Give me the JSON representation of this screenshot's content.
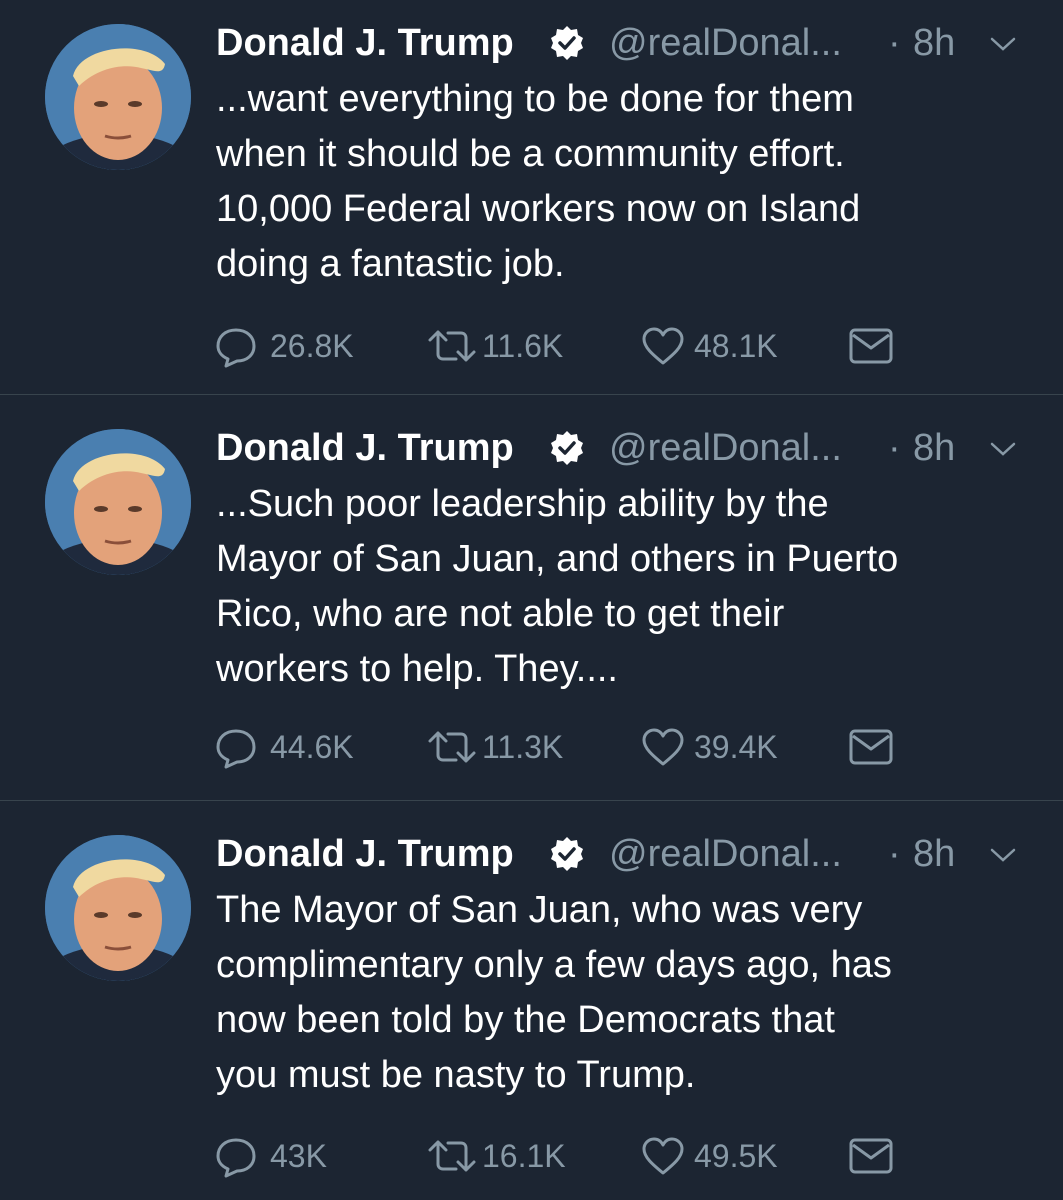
{
  "colors": {
    "background": "#1c2532",
    "divider": "#38444d",
    "text": "#ffffff",
    "muted": "#8899a6",
    "verified_badge": "#ffffff"
  },
  "tweets": [
    {
      "name": "Donald J. Trump",
      "handle": "@realDonal...",
      "dot": "·",
      "time": "8h",
      "text": "...want everything to be done for them\nwhen it should be a community effort.\n10,000 Federal workers now on Island\ndoing a fantastic job.",
      "replies": "26.8K",
      "retweets": "11.6K",
      "likes": "48.1K"
    },
    {
      "name": "Donald J. Trump",
      "handle": "@realDonal...",
      "dot": "·",
      "time": "8h",
      "text": "...Such poor leadership ability by the\nMayor of San Juan, and others in Puerto\nRico, who are not able to get their\nworkers to help. They....",
      "replies": "44.6K",
      "retweets": "11.3K",
      "likes": "39.4K"
    },
    {
      "name": "Donald J. Trump",
      "handle": "@realDonal...",
      "dot": "·",
      "time": "8h",
      "text": "The Mayor of San Juan, who was very\ncomplimentary only a few days ago, has\nnow been told by the Democrats that\nyou must be nasty to Trump.",
      "replies": "43K",
      "retweets": "16.1K",
      "likes": "49.5K"
    }
  ],
  "icons": {
    "avatar": "profile-photo",
    "verified": "verified-badge-icon",
    "chevron": "chevron-down-icon",
    "reply": "reply-icon",
    "retweet": "retweet-icon",
    "like": "heart-icon",
    "message": "envelope-icon"
  }
}
